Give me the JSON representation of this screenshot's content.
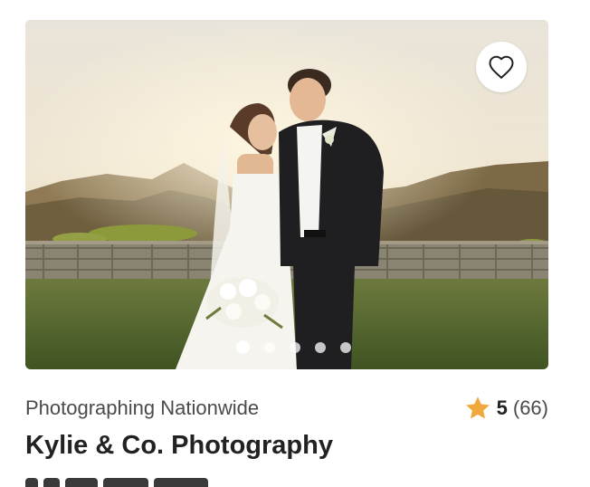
{
  "listing": {
    "location": "Photographing Nationwide",
    "rating_value": "5",
    "review_count": "(66)",
    "title": "Kylie & Co. Photography"
  },
  "icons": {
    "favorite": "heart-outline-icon",
    "rating": "star-icon"
  },
  "carousel": {
    "total_slides": 5,
    "active_slide": 1
  },
  "colors": {
    "star": "#F2A93B",
    "title_text": "#222222",
    "secondary_text": "#4a4a4a"
  }
}
